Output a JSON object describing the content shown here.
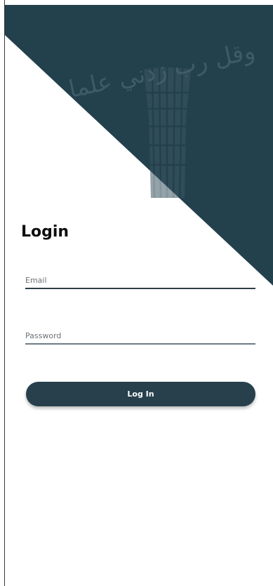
{
  "colors": {
    "primary": "#23404d",
    "background": "#ffffff",
    "text": "#0e0e0e"
  },
  "header": {
    "calligraphy": "وقل رب زدني علما",
    "logo": "minaret-logo"
  },
  "login": {
    "title": "Login",
    "email_placeholder": "Email",
    "email_value": "",
    "password_placeholder": "Password",
    "password_value": "",
    "submit_label": "Log In"
  }
}
